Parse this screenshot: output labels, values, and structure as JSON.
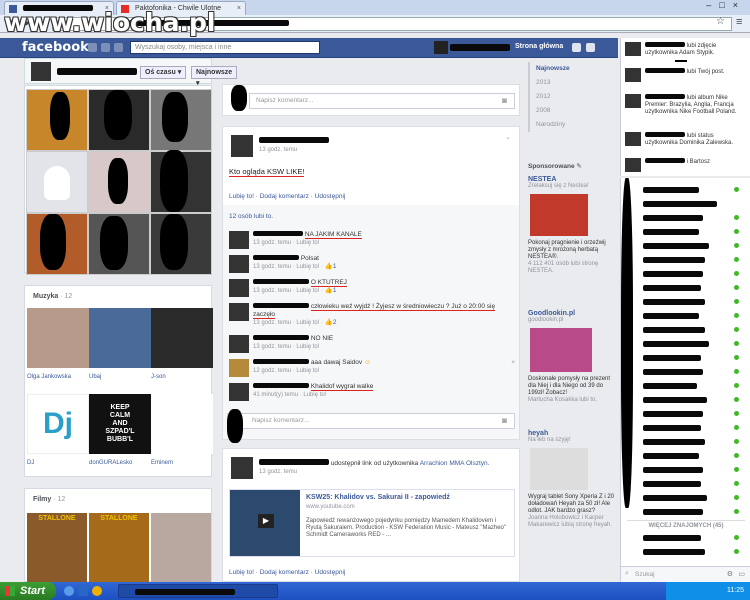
{
  "browser": {
    "tabs": [
      {
        "title": "",
        "icon": "facebook-icon"
      },
      {
        "title": "Paktofonika - Chwile Ulotne",
        "icon": "youtube-icon"
      }
    ],
    "url": ""
  },
  "watermark": "www.wiocha.pl",
  "fb": {
    "logo": "facebook",
    "search_placeholder": "Wyszukaj osoby, miejsca i inne",
    "home": "Strona główna"
  },
  "profile": {
    "filter1": "Oś czasu",
    "filter2": "Najnowsze"
  },
  "music": {
    "title": "Muzyka",
    "count": "· 12",
    "items": [
      "Olga Jankowska",
      "Ubaj",
      "J-son",
      "DJ",
      "donGURALesko",
      "Eminem"
    ],
    "keep_calm": "KEEP\nCALM\nAND\nSZPAD'L\nBUBB'L",
    "dj": "Dj"
  },
  "films": {
    "title": "Filmy",
    "count": "· 12",
    "posters": [
      "STALLONE",
      "STALLONE",
      ""
    ]
  },
  "comment_box": {
    "placeholder": "Napisz komentarz..."
  },
  "post1": {
    "time": "13 godz. temu",
    "text": "Kto ogląda KSW LIKE!",
    "actions": "Lubię to! · Dodaj komentarz · Udostępnij",
    "likes": "12 osób lubi to.",
    "comments": [
      {
        "text": "NA JAKIM KANALE",
        "meta": "13 godz. temu · Lubię to!",
        "likes": ""
      },
      {
        "text": "Polsat",
        "meta": "13 godz. temu · Lubię to! · ",
        "likes": "1"
      },
      {
        "text": "O KTUTREJ",
        "meta": "13 godz. temu · Lubię to! · ",
        "likes": "1"
      },
      {
        "text": "człowieku weź wyjdź ! Żyjesz w średniowieczu ? Już o 20:00 się zaczęło",
        "meta": "13 godz. temu · Lubię to! · ",
        "likes": "2"
      },
      {
        "text": "NO NIE",
        "meta": "13 godz. temu · Lubię to!",
        "likes": ""
      },
      {
        "text": "aaa dawaj Saidov",
        "meta": "12 godz. temu · Lubię to!",
        "likes": ""
      },
      {
        "text": "Khalidof wygrał walke",
        "meta": "41 minut(y) temu · Lubię to!",
        "likes": ""
      }
    ]
  },
  "post2": {
    "shared": "udostępnił link od użytkownika",
    "source": "Arrachion MMA Olsztyn.",
    "time": "13 godz. temu",
    "link_title": "KSW25: Khalidov vs. Sakurai II - zapowiedź",
    "link_url": "www.youtube.com",
    "link_desc": "Zapowiedź rewanżowego pojedynku pomiędzy Mamedem Khalidovem i Ryutą Sakuraiem. Production - KSW Federation Music - Mateusz \"Mazheo\" Schmidt Cameraworks RED - ...",
    "actions": "Lubię to! · Dodaj komentarz · Udostępnij"
  },
  "years": [
    "Najnowsze",
    "2013",
    "2012",
    "2008",
    "Narodziny"
  ],
  "sponsored": {
    "title": "Sponsorowane",
    "ads": [
      {
        "title": "NESTEA",
        "sub": "Zrelaksuj się z Nestea!",
        "text": "Pokonaj pragnienie i orzeźwij zmysły z mrożoną herbatą NESTEA®.",
        "likes": "4 112 401 osób lubi stronę NESTEA."
      },
      {
        "title": "Goodlookin.pl",
        "sub": "goodlookin.pl",
        "text": "Doskonałe pomysły na prezent dla Niej i dla Niego od 39 do 199zł! Zobacz!",
        "likes": "Martucha Kosakka lubi to."
      },
      {
        "title": "heyah",
        "sub": "Na łeb na szyję!",
        "text": "Wygraj tablet Sony Xperia Z i 20 doładowań Heyah za 50 zł! Ale odlot. JAK bardzo grasz?",
        "likes": "Joanna Holubowicz i Kacper Makarewicz lubią stronę heyah."
      }
    ]
  },
  "ticker": [
    {
      "text": "lubi zdjęcie użytkownika Adam Stypik."
    },
    {
      "text": "lubi Twój post."
    },
    {
      "text": "lubi album Nike Premier: Brazylia, Anglia, Francja użytkownika Nike Football Poland."
    },
    {
      "text": "lubi status użytkownika Dominika Zalewska."
    },
    {
      "text": "i Bartosz"
    }
  ],
  "chat": {
    "more": "WIĘCEJ ZNAJOMYCH (45)",
    "search": "Szukaj"
  },
  "taskbar": {
    "start": "Start",
    "time": "11:25"
  }
}
